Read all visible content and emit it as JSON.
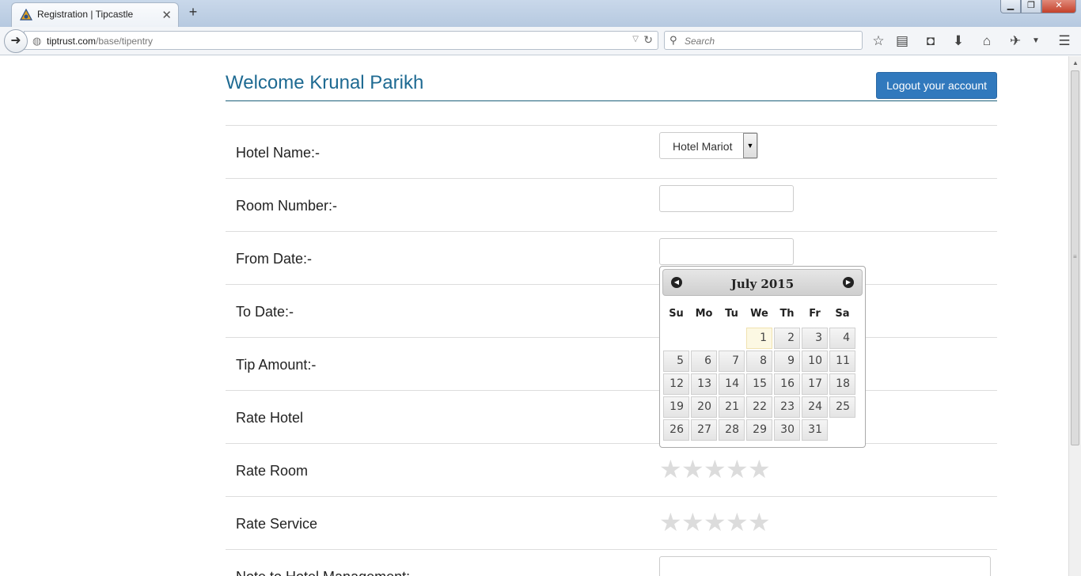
{
  "browser": {
    "tab_title": "Registration | Tipcastle",
    "url_domain": "tiptrust.com",
    "url_path": "/base/tipentry",
    "search_placeholder": "Search"
  },
  "page": {
    "welcome": "Welcome Krunal Parikh",
    "logout_label": "Logout your account"
  },
  "form": {
    "hotel_label": "Hotel Name:-",
    "hotel_selected": "Hotel Mariot",
    "room_label": "Room Number:-",
    "from_label": "From Date:-",
    "to_label": "To Date:-",
    "tip_label": "Tip Amount:-",
    "rate_hotel_label": "Rate Hotel",
    "rate_room_label": "Rate Room",
    "rate_service_label": "Rate Service",
    "note_label": "Note to Hotel Management:-",
    "rate_room_value": 0,
    "rate_service_value": 0
  },
  "datepicker": {
    "title": "July 2015",
    "weekdays": [
      "Su",
      "Mo",
      "Tu",
      "We",
      "Th",
      "Fr",
      "Sa"
    ],
    "weeks": [
      [
        "",
        "",
        "",
        "1",
        "2",
        "3",
        "4"
      ],
      [
        "5",
        "6",
        "7",
        "8",
        "9",
        "10",
        "11"
      ],
      [
        "12",
        "13",
        "14",
        "15",
        "16",
        "17",
        "18"
      ],
      [
        "19",
        "20",
        "21",
        "22",
        "23",
        "24",
        "25"
      ],
      [
        "26",
        "27",
        "28",
        "29",
        "30",
        "31",
        ""
      ]
    ],
    "highlighted_day": "1"
  }
}
